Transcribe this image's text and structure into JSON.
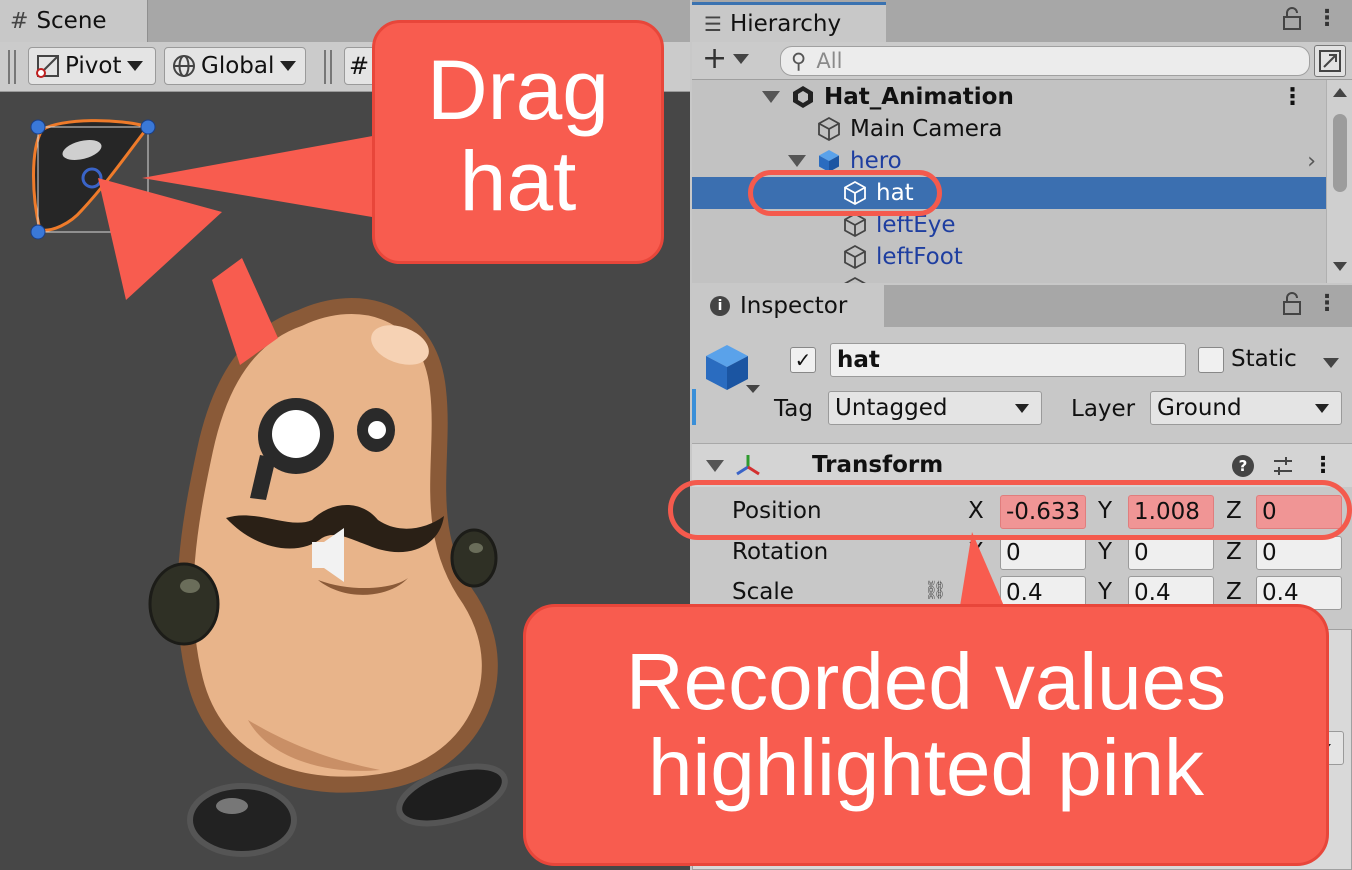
{
  "scene": {
    "tab_label": "Scene",
    "pivot_label": "Pivot",
    "global_label": "Global"
  },
  "hierarchy": {
    "tab_label": "Hierarchy",
    "search_placeholder": "All",
    "items": [
      {
        "label": "Hat_Animation",
        "type": "scene-root"
      },
      {
        "label": "Main Camera",
        "type": "object"
      },
      {
        "label": "hero",
        "type": "prefab"
      },
      {
        "label": "hat",
        "type": "prefab",
        "selected": true
      },
      {
        "label": "leftEye",
        "type": "prefab"
      },
      {
        "label": "leftFoot",
        "type": "prefab"
      }
    ]
  },
  "inspector": {
    "tab_label": "Inspector",
    "object_name": "hat",
    "static_label": "Static",
    "tag_label": "Tag",
    "tag_value": "Untagged",
    "layer_label": "Layer",
    "layer_value": "Ground",
    "component_title": "Transform",
    "position": {
      "label": "Position",
      "x": "-0.633",
      "y": "1.008",
      "z": "0"
    },
    "rotation": {
      "label": "Rotation",
      "x": "0",
      "y": "0",
      "z": "0"
    },
    "scale": {
      "label": "Scale",
      "x": "0.4",
      "y": "0.4",
      "z": "0.4"
    },
    "axis_x": "X",
    "axis_y": "Y",
    "axis_z": "Z"
  },
  "callouts": {
    "drag_line1": "Drag",
    "drag_line2": "hat",
    "recorded_line1": "Recorded values",
    "recorded_line2": "highlighted pink"
  },
  "colors": {
    "callout": "#f85c4f",
    "selection": "#3b6fb0",
    "recorded_field": "#f09595"
  }
}
